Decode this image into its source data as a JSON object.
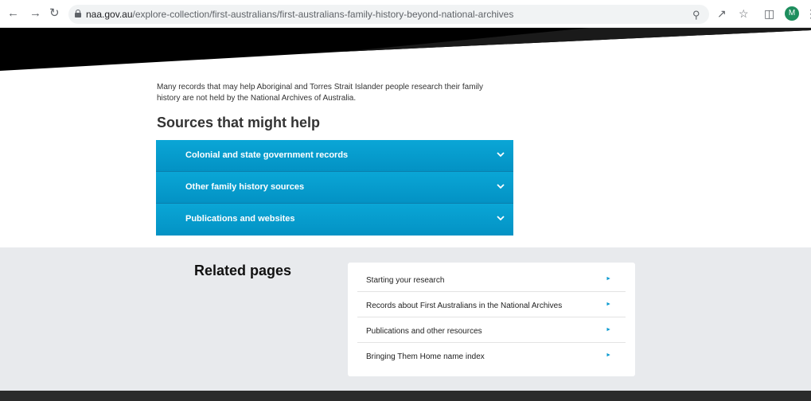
{
  "browser": {
    "url_host": "naa.gov.au",
    "url_path": "/explore-collection/first-australians/first-australians-family-history-beyond-national-archives",
    "avatar_letter": "M"
  },
  "intro": {
    "text": "Many records that may help Aboriginal and Torres Strait Islander people research their family history are not held by the National Archives of Australia."
  },
  "sources": {
    "heading": "Sources that might help",
    "items": [
      {
        "label": "Colonial and state government records"
      },
      {
        "label": "Other family history sources"
      },
      {
        "label": "Publications and websites"
      }
    ]
  },
  "related": {
    "title": "Related pages",
    "items": [
      {
        "label": "Starting your research"
      },
      {
        "label": "Records about First Australians in the National Archives"
      },
      {
        "label": "Publications and other resources"
      },
      {
        "label": "Bringing Them Home name index"
      }
    ]
  },
  "colors": {
    "accordion": "#0392c4",
    "hero_black": "#000000",
    "related_bg": "#e8eaed",
    "arrow": "#0a9ad0"
  }
}
